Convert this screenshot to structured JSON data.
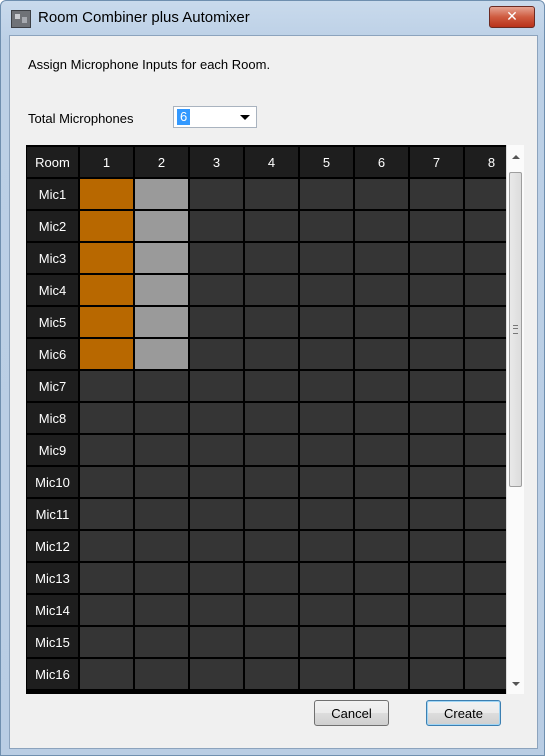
{
  "window": {
    "title": "Room Combiner plus Automixer",
    "close_label": "✕"
  },
  "instruction": "Assign Microphone Inputs for each Room.",
  "total_microphones": {
    "label": "Total Microphones",
    "value": "6"
  },
  "grid": {
    "corner_header": "Room",
    "room_headers": [
      "1",
      "2",
      "3",
      "4",
      "5",
      "6",
      "7",
      "8"
    ],
    "mic_labels": [
      "Mic1",
      "Mic2",
      "Mic3",
      "Mic4",
      "Mic5",
      "Mic6",
      "Mic7",
      "Mic8",
      "Mic9",
      "Mic10",
      "Mic11",
      "Mic12",
      "Mic13",
      "Mic14",
      "Mic15",
      "Mic16"
    ],
    "assignments": [
      [
        1,
        2,
        0,
        0,
        0,
        0,
        0,
        0
      ],
      [
        1,
        2,
        0,
        0,
        0,
        0,
        0,
        0
      ],
      [
        1,
        2,
        0,
        0,
        0,
        0,
        0,
        0
      ],
      [
        1,
        2,
        0,
        0,
        0,
        0,
        0,
        0
      ],
      [
        1,
        2,
        0,
        0,
        0,
        0,
        0,
        0
      ],
      [
        1,
        2,
        0,
        0,
        0,
        0,
        0,
        0
      ],
      [
        0,
        0,
        0,
        0,
        0,
        0,
        0,
        0
      ],
      [
        0,
        0,
        0,
        0,
        0,
        0,
        0,
        0
      ],
      [
        0,
        0,
        0,
        0,
        0,
        0,
        0,
        0
      ],
      [
        0,
        0,
        0,
        0,
        0,
        0,
        0,
        0
      ],
      [
        0,
        0,
        0,
        0,
        0,
        0,
        0,
        0
      ],
      [
        0,
        0,
        0,
        0,
        0,
        0,
        0,
        0
      ],
      [
        0,
        0,
        0,
        0,
        0,
        0,
        0,
        0
      ],
      [
        0,
        0,
        0,
        0,
        0,
        0,
        0,
        0
      ],
      [
        0,
        0,
        0,
        0,
        0,
        0,
        0,
        0
      ],
      [
        0,
        0,
        0,
        0,
        0,
        0,
        0,
        0
      ]
    ],
    "colors": {
      "assigned": "#b86800",
      "secondary": "#9a9a9a",
      "empty": "#353535"
    }
  },
  "buttons": {
    "cancel": "Cancel",
    "create": "Create"
  }
}
